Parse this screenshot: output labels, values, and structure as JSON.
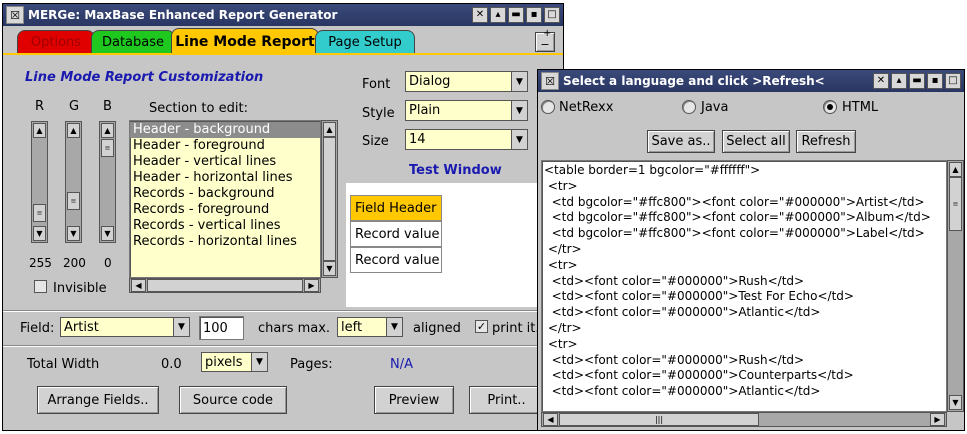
{
  "main_window": {
    "title": "MERGe: MaxBase Enhanced Report Generator",
    "tabs": [
      {
        "label": "Options",
        "color": "#e00000",
        "text_color": "#a00000"
      },
      {
        "label": "Database",
        "color": "#1ec81e"
      },
      {
        "label": "Line Mode Report",
        "color": "#ffc800"
      },
      {
        "label": "Page Setup",
        "color": "#33cccc"
      }
    ],
    "tab_scroll": {
      "minus": "−",
      "plus": "+"
    },
    "heading": "Line Mode Report Customization",
    "rgb": {
      "labels": [
        "R",
        "G",
        "B"
      ],
      "values": [
        "255",
        "200",
        "0"
      ],
      "levels": [
        1.0,
        0.78,
        0.0
      ]
    },
    "invisible_label": "Invisible",
    "section_label": "Section to edit:",
    "sections": [
      "Header - background",
      "Header - foreground",
      "Header - vertical lines",
      "Header - horizontal lines",
      "Records - background",
      "Records - foreground",
      "Records - vertical lines",
      "Records - horizontal lines"
    ],
    "selected_section": 0,
    "font": {
      "label": "Font",
      "value": "Dialog"
    },
    "style": {
      "label": "Style",
      "value": "Plain"
    },
    "size": {
      "label": "Size",
      "value": "14"
    },
    "test_window": {
      "title": "Test Window",
      "header": "Field Header",
      "header_color": "#ffc800",
      "rows": [
        "Record value",
        "Record value"
      ]
    },
    "field": {
      "label": "Field:",
      "value": "Artist",
      "chars": "100",
      "chars_label": "chars max.",
      "align": "left",
      "aligned_label": "aligned",
      "print_label": "print it.",
      "print_checked": true
    },
    "total_width": {
      "label": "Total Width",
      "value": "0.0",
      "unit": "pixels",
      "pages_label": "Pages:",
      "pages_value": "N/A"
    },
    "buttons": {
      "arrange": "Arrange Fields..",
      "source": "Source code",
      "preview": "Preview",
      "print": "Print.."
    }
  },
  "lang_window": {
    "title": "Select a language and click >Refresh<",
    "languages": [
      "NetRexx",
      "Java",
      "HTML"
    ],
    "selected": 2,
    "buttons": {
      "save": "Save as..",
      "select_all": "Select all",
      "refresh": "Refresh"
    },
    "code": [
      "<table border=1 bgcolor=\"#ffffff\">",
      " <tr>",
      "  <td bgcolor=\"#ffc800\"><font color=\"#000000\">Artist</td>",
      "  <td bgcolor=\"#ffc800\"><font color=\"#000000\">Album</td>",
      "  <td bgcolor=\"#ffc800\"><font color=\"#000000\">Label</td>",
      " </tr>",
      " <tr>",
      "  <td><font color=\"#000000\">Rush</td>",
      "  <td><font color=\"#000000\">Test For Echo</td>",
      "  <td><font color=\"#000000\">Atlantic</td>",
      " </tr>",
      " <tr>",
      "  <td><font color=\"#000000\">Rush</td>",
      "  <td><font color=\"#000000\">Counterparts</td>",
      "  <td><font color=\"#000000\">Atlantic</td>"
    ]
  }
}
